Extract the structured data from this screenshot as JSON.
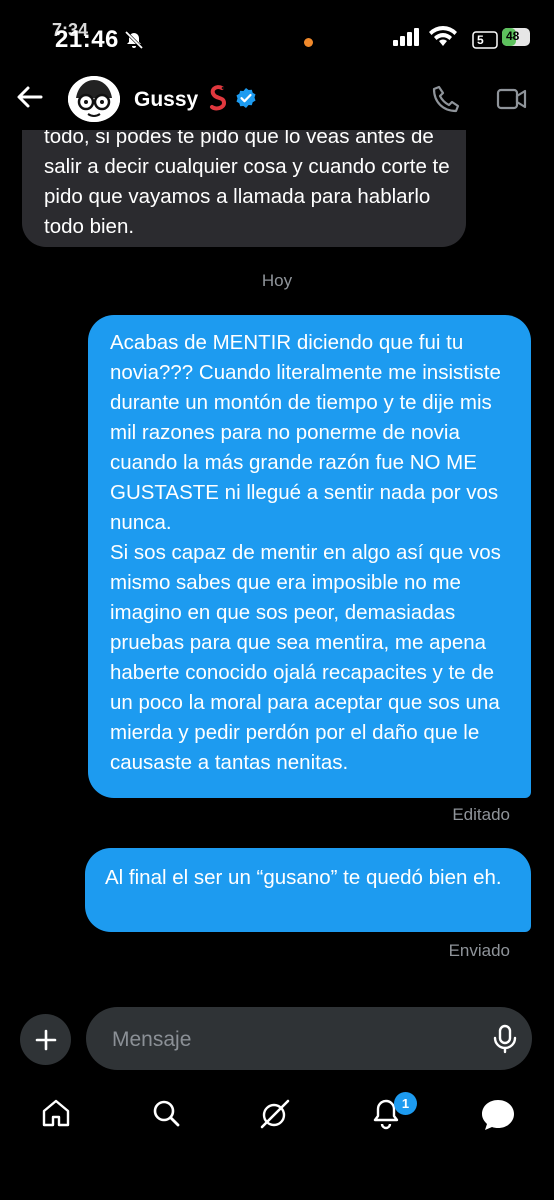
{
  "status_bar": {
    "time": "21:46",
    "time_overlay": "7:34",
    "battery": "48",
    "network": "5"
  },
  "header": {
    "name": "Gussy",
    "name_emoji": "worm-emoji",
    "verified": "verified-badge-icon"
  },
  "messages": {
    "incoming_partial": "todo, si podes te pido que lo veas antes de salir a decir cualquier cosa y cuando corte te pido que vayamos a llamada para hablarlo todo bien.",
    "day_separator": "Hoy",
    "outgoing_1": "Acabas de MENTIR diciendo que fui tu novia??? Cuando literalmente me insististe durante un montón de tiempo y te dije mis mil razones para no ponerme de novia cuando la más grande razón fue NO ME GUSTASTE ni llegué a sentir nada por vos nunca.\n Si sos capaz de mentir en algo así que vos mismo sabes que era imposible no me imagino en que sos peor, demasiadas pruebas para que sea mentira, me apena haberte conocido ojalá recapacites y te de un poco la moral para aceptar que sos una mierda y pedir perdón por el daño que le causaste a tantas nenitas.",
    "outgoing_1_status": "Editado",
    "outgoing_2": "Al final el ser un “gusano” te quedó bien eh.",
    "outgoing_2_status": "Enviado"
  },
  "composer": {
    "placeholder": "Mensaje"
  },
  "bottom_nav": {
    "notifications_badge": "1",
    "items": [
      "home-icon",
      "search-icon",
      "grok-icon",
      "notifications-icon",
      "messages-icon"
    ]
  },
  "colors": {
    "accent": "#1d9bf0",
    "incoming_bubble": "#2b2b2f",
    "background": "#000000",
    "muted_text": "#8f949a"
  }
}
